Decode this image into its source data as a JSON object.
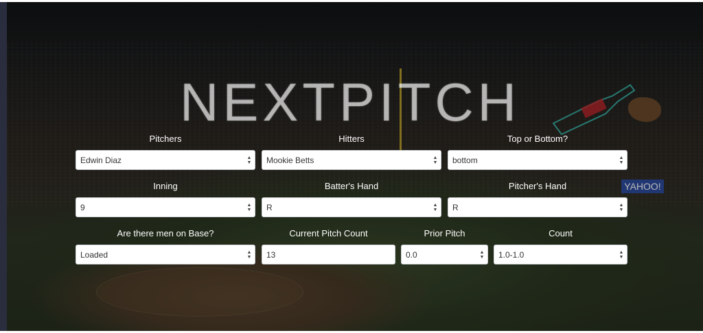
{
  "app": {
    "logo": "NEXTPITCH"
  },
  "background": {
    "banner_text": "YAHOO!"
  },
  "form": {
    "pitchers": {
      "label": "Pitchers",
      "value": "Edwin Diaz"
    },
    "hitters": {
      "label": "Hitters",
      "value": "Mookie Betts"
    },
    "top_bottom": {
      "label": "Top or Bottom?",
      "value": "bottom"
    },
    "inning": {
      "label": "Inning",
      "value": "9"
    },
    "batters_hand": {
      "label": "Batter's Hand",
      "value": "R"
    },
    "pitchers_hand": {
      "label": "Pitcher's Hand",
      "value": "R"
    },
    "men_on_base": {
      "label": "Are there men on Base?",
      "value": "Loaded"
    },
    "pitch_count": {
      "label": "Current Pitch Count",
      "value": "13"
    },
    "prior_pitch": {
      "label": "Prior Pitch",
      "value": "0.0"
    },
    "count": {
      "label": "Count",
      "value": "1.0-1.0"
    }
  },
  "icons": {
    "select_arrows": "up-down-arrow-icon"
  },
  "colors": {
    "field_bg": "#ffffff",
    "label_text": "#ffffff",
    "frame_left": "#2a2d3e"
  }
}
